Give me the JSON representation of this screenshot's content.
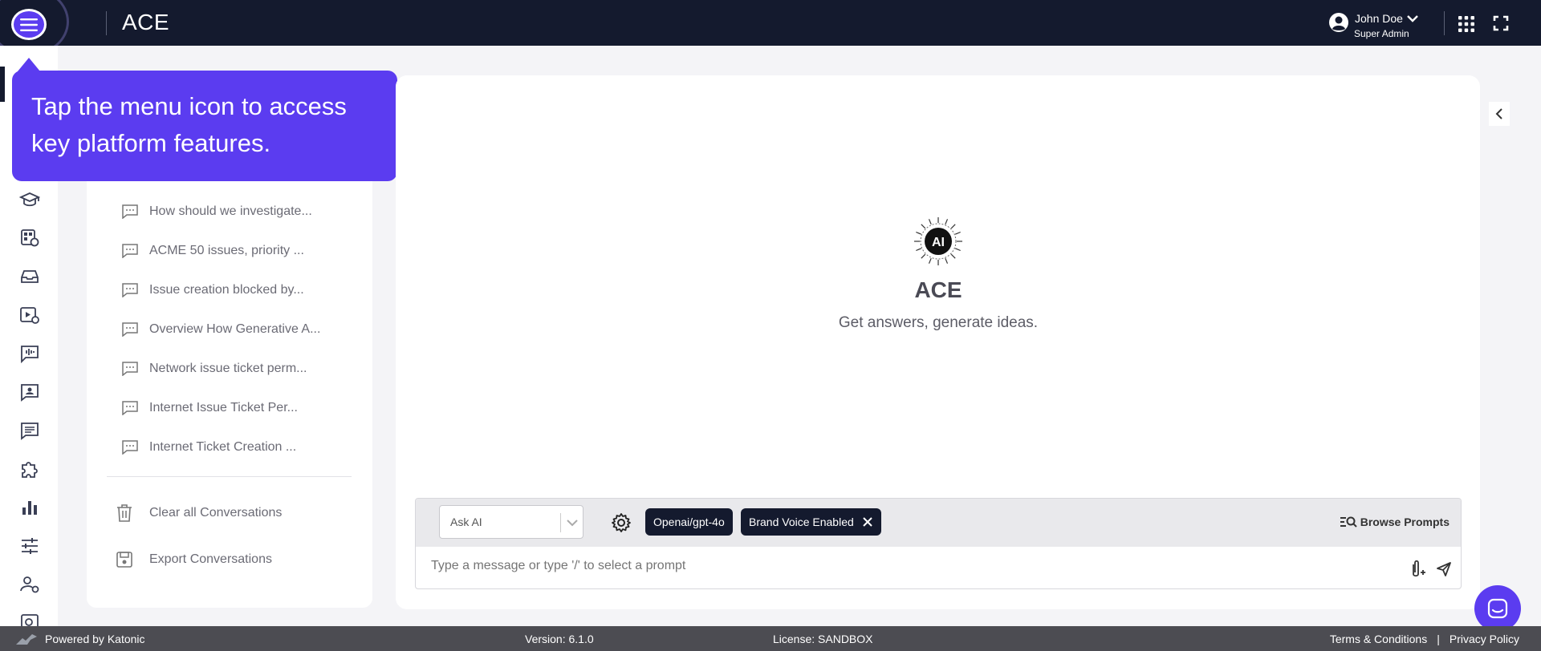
{
  "header": {
    "app_title": "ACE",
    "user_name": "John Doe",
    "user_role": "Super Admin",
    "icons": [
      "menu-icon",
      "user-circle-icon",
      "chevron-down-icon",
      "apps-grid-icon",
      "fullscreen-icon"
    ]
  },
  "tooltip": {
    "text": "Tap the menu icon to access key platform features."
  },
  "sidebar": {
    "icons": [
      "graduation-cap-icon",
      "id-card-link-icon",
      "inbox-tray-icon",
      "video-settings-icon",
      "audio-chat-icon",
      "contact-chat-icon",
      "list-chat-icon",
      "puzzle-icon",
      "bar-chart-icon",
      "sliders-icon",
      "user-settings-icon",
      "search-doc-icon"
    ]
  },
  "conversations": {
    "items": [
      {
        "label": "How should we investigate..."
      },
      {
        "label": "ACME 50 issues, priority ..."
      },
      {
        "label": "Issue creation blocked by..."
      },
      {
        "label": "Overview How Generative A..."
      },
      {
        "label": "Network issue ticket perm..."
      },
      {
        "label": "Internet Issue Ticket Per..."
      },
      {
        "label": "Internet Ticket Creation ..."
      }
    ],
    "clear_label": "Clear all Conversations",
    "export_label": "Export Conversations"
  },
  "main": {
    "logo_text": "AI",
    "title": "ACE",
    "subtitle": "Get answers, generate ideas."
  },
  "composer": {
    "mode_value": "Ask AI",
    "model_chip": "Openai/gpt-4o",
    "brand_chip": "Brand Voice Enabled",
    "browse_label": "Browse Prompts",
    "placeholder": "Type a message or type '/' to select a prompt"
  },
  "footer": {
    "powered": "Powered by Katonic",
    "version": "Version: 6.1.0",
    "license": "License: SANDBOX",
    "terms": "Terms & Conditions",
    "separator": "|",
    "privacy": "Privacy Policy"
  },
  "colors": {
    "topbar": "#141a2e",
    "accent": "#5b3cf0",
    "footer": "#4c4c52"
  }
}
